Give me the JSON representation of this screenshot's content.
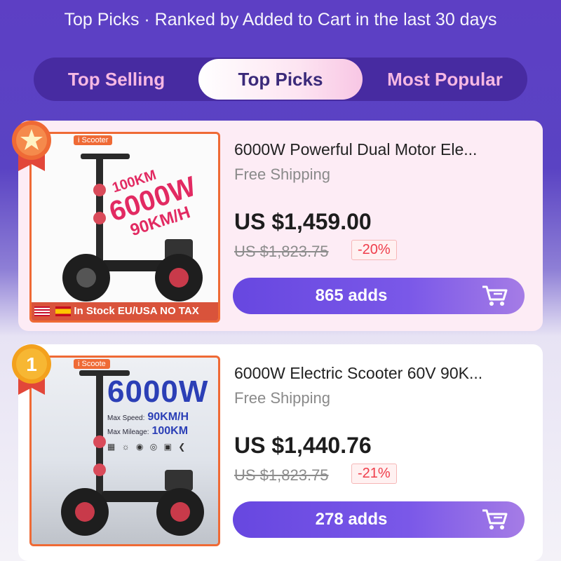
{
  "header": {
    "subtitle": "Top Picks · Ranked by Added to Cart in the last 30 days"
  },
  "tabs": [
    {
      "label": "Top Selling",
      "active": false
    },
    {
      "label": "Top Picks",
      "active": true
    },
    {
      "label": "Most Popular",
      "active": false
    }
  ],
  "products": [
    {
      "rank_badge": "star",
      "image_tag": "i Scooter",
      "image_promo": [
        "100KM",
        "6000W",
        "90KM/H"
      ],
      "image_stock": "In Stock  EU/USA NO TAX",
      "title": "6000W Powerful Dual Motor Ele...",
      "shipping": "Free Shipping",
      "price": "US $1,459.00",
      "original_price": "US $1,823.75",
      "discount": "-20%",
      "adds": "865 adds"
    },
    {
      "rank_badge": "1",
      "image_tag": "i Scoote",
      "image_promo": [
        "6000W",
        "Max Speed:",
        "90KM/H",
        "Max Mileage:",
        "100KM"
      ],
      "title": "6000W Electric Scooter 60V 90K...",
      "shipping": "Free Shipping",
      "price": "US $1,440.76",
      "original_price": "US $1,823.75",
      "discount": "-21%",
      "adds": "278 adds"
    }
  ],
  "colors": {
    "accent_purple": "#6747e0",
    "discount_red": "#ef3d4a",
    "tab_pink": "#f6b8e3",
    "image_border": "#ef6a35"
  },
  "icons": [
    "star-badge-icon",
    "rank-one-badge-icon",
    "cart-icon"
  ]
}
